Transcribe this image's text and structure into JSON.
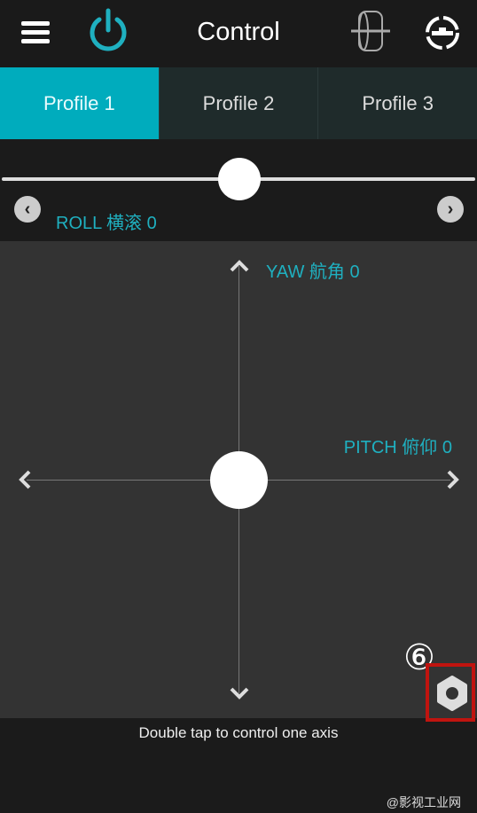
{
  "header": {
    "title": "Control",
    "icons": [
      "menu-icon",
      "power-icon",
      "gimbal-motor-icon",
      "calibration-icon"
    ],
    "accent": "#1fb0c0"
  },
  "tabs": [
    {
      "label": "Profile 1",
      "active": true
    },
    {
      "label": "Profile 2",
      "active": false
    },
    {
      "label": "Profile 3",
      "active": false
    }
  ],
  "roll": {
    "label": "ROLL 横滚 0",
    "value": 0
  },
  "pad": {
    "yaw_label": "YAW 航角 0",
    "pitch_label": "PITCH 俯仰 0"
  },
  "hint": "Double tap to control one axis",
  "annotation": {
    "number": "⑥",
    "highlight_color": "#c0140f"
  },
  "watermark": "@影视工业网"
}
